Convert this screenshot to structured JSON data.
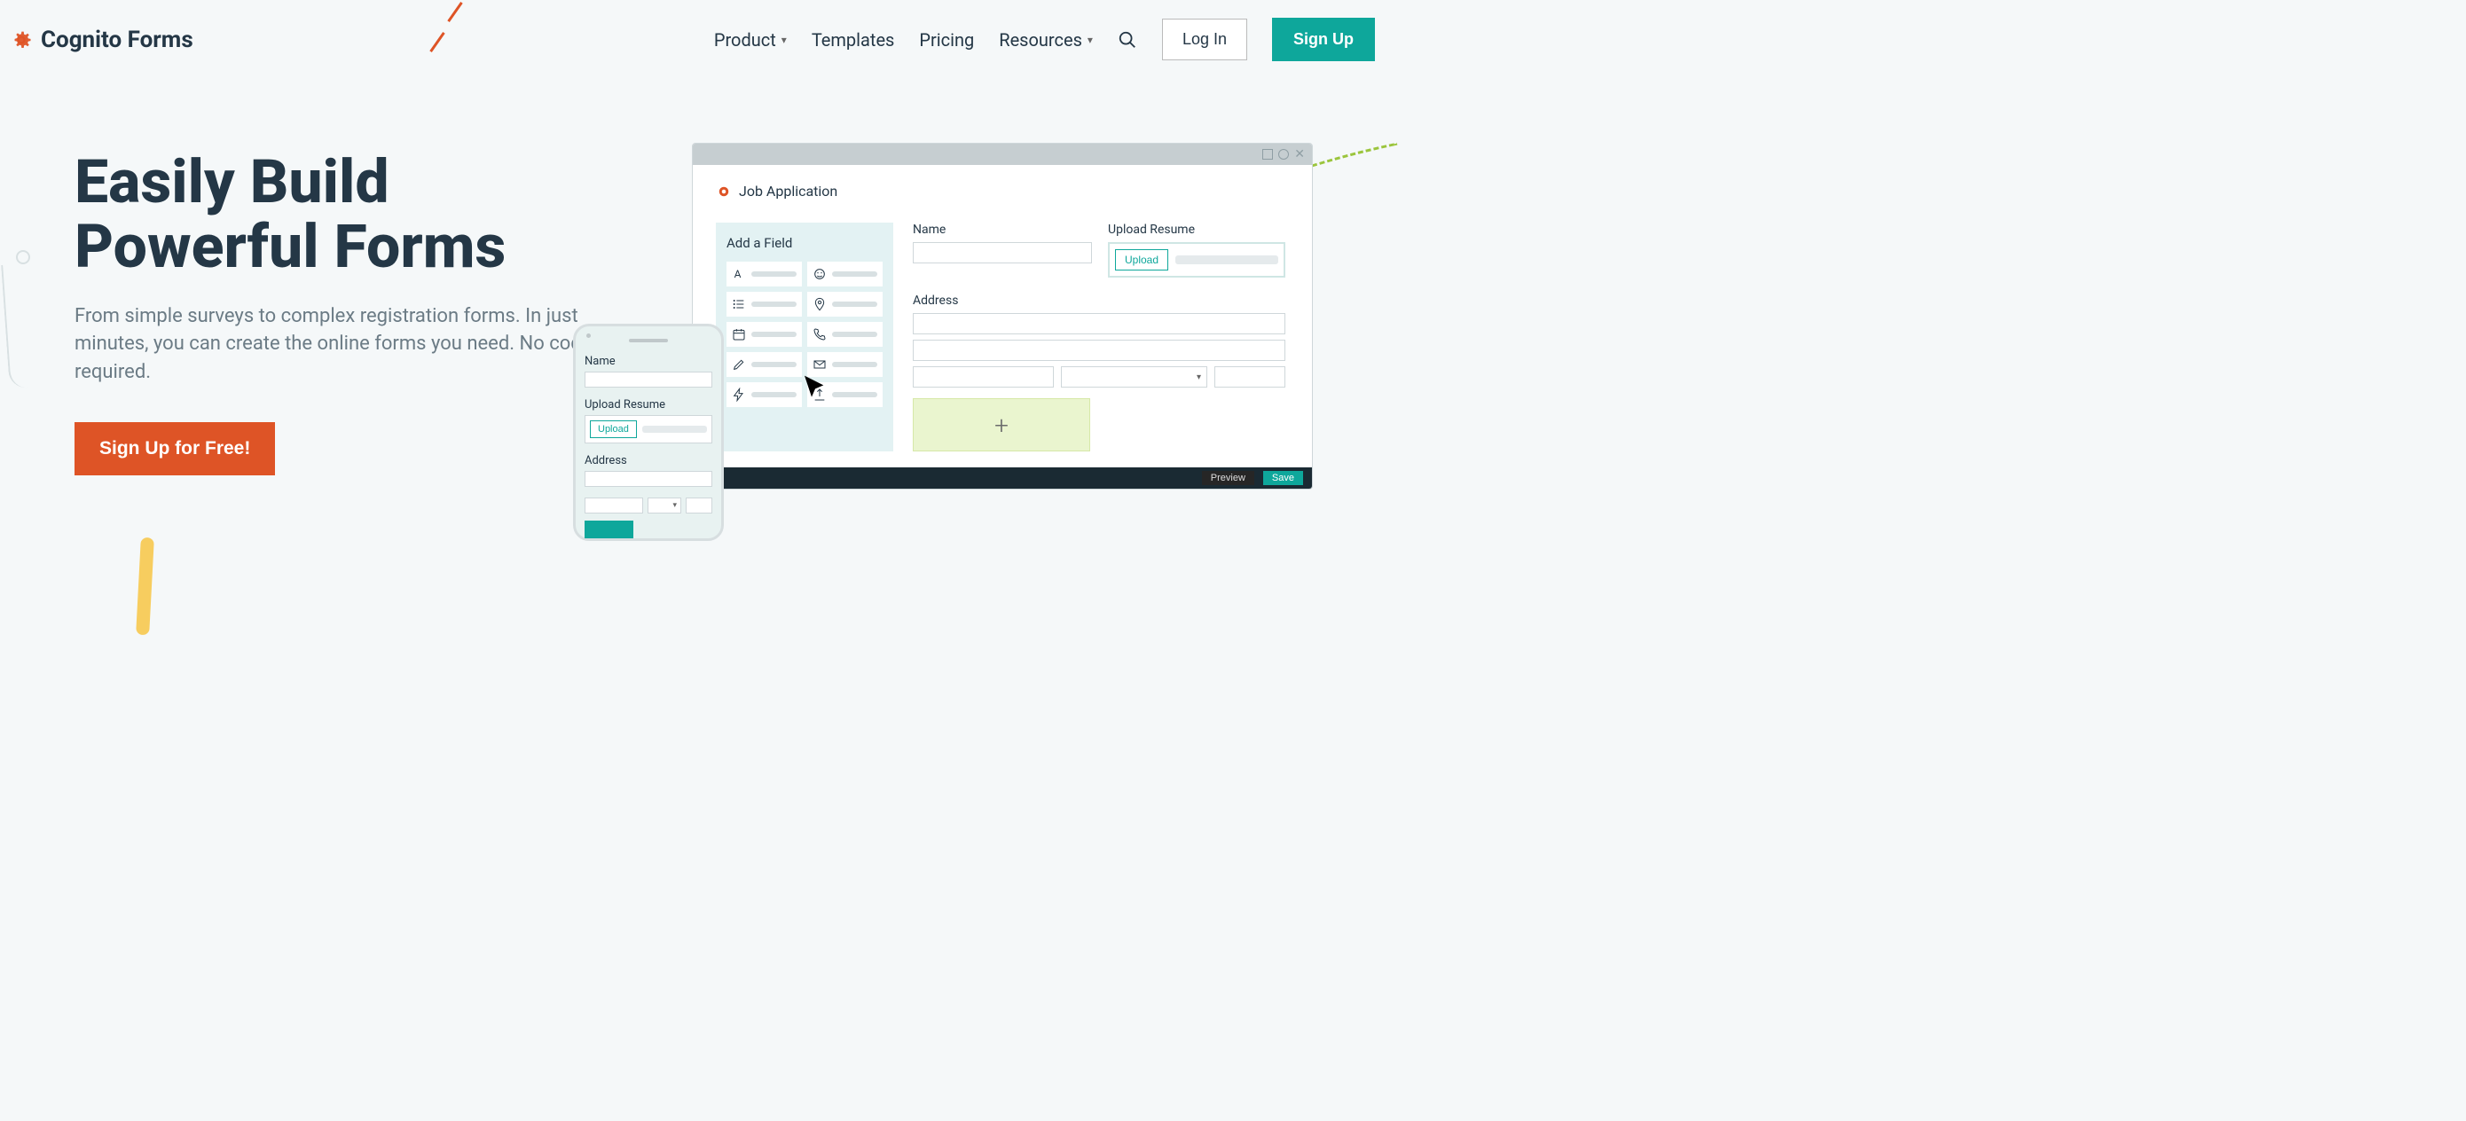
{
  "brand": {
    "name": "Cognito Forms"
  },
  "nav": {
    "product": "Product",
    "templates": "Templates",
    "pricing": "Pricing",
    "resources": "Resources",
    "login": "Log In",
    "signup": "Sign Up"
  },
  "hero": {
    "title_line1": "Easily Build",
    "title_line2": "Powerful Forms",
    "subtitle": "From simple surveys to complex registration forms. In just minutes, you can create the online forms you need. No code required.",
    "cta": "Sign Up for Free!"
  },
  "builder": {
    "form_title": "Job Application",
    "palette_title": "Add a Field",
    "labels": {
      "name": "Name",
      "upload_resume": "Upload Resume",
      "upload_btn": "Upload",
      "address": "Address"
    },
    "footer": {
      "preview": "Preview",
      "save": "Save"
    }
  },
  "phone": {
    "name_label": "Name",
    "upload_label": "Upload Resume",
    "upload_btn": "Upload",
    "address_label": "Address"
  },
  "colors": {
    "brand_orange": "#de5426",
    "brand_teal": "#0ea79b",
    "text_dark": "#243746"
  }
}
